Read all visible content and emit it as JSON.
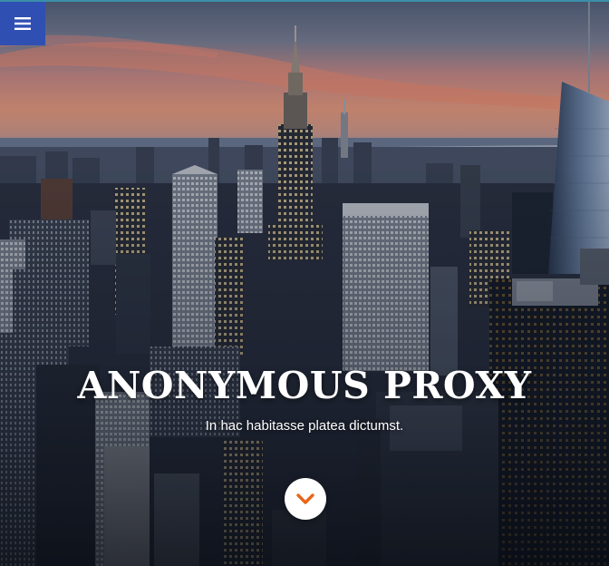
{
  "hero": {
    "title": "ANONYMOUS PROXY",
    "subtitle": "In hac habitasse platea dictumst.",
    "background": "city-skyline-sunset-photo"
  },
  "menu_button": {
    "icon": "hamburger-menu-icon",
    "color": "#2f4fb3"
  },
  "scroll_button": {
    "icon": "chevron-down-icon",
    "icon_color": "#e8651a"
  }
}
